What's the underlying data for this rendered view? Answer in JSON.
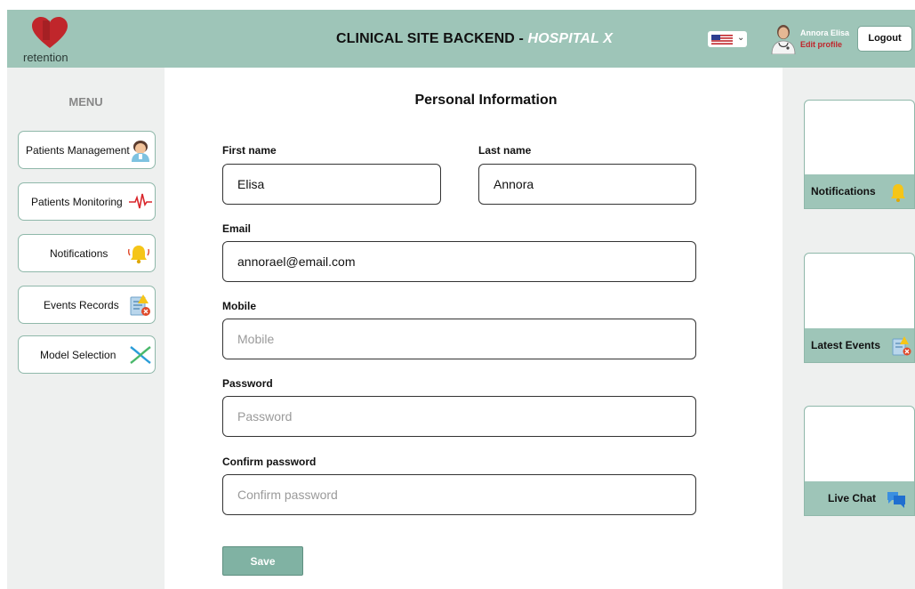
{
  "header": {
    "logo_text": "retention",
    "title": "CLINICAL SITE BACKEND - ",
    "hospital": "HOSPITAL X",
    "language_icon": "us-flag-icon",
    "user_name": "Annora Elisa",
    "edit_profile": "Edit profile",
    "logout": "Logout"
  },
  "sidebar": {
    "title": "MENU",
    "items": [
      {
        "label": "Patients Management",
        "icon": "doctor-icon"
      },
      {
        "label": "Patients Monitoring",
        "icon": "heartbeat-icon"
      },
      {
        "label": "Notifications",
        "icon": "bell-icon"
      },
      {
        "label": "Events Records",
        "icon": "event-list-icon"
      },
      {
        "label": "Model Selection",
        "icon": "model-cross-icon"
      }
    ]
  },
  "form": {
    "title": "Personal Information",
    "first_name_label": "First name",
    "first_name_value": "Elisa",
    "last_name_label": "Last name",
    "last_name_value": "Annora",
    "email_label": "Email",
    "email_value": "annorael@email.com",
    "mobile_label": "Mobile",
    "mobile_placeholder": "Mobile",
    "password_label": "Password",
    "password_placeholder": "Password",
    "confirm_label": "Confirm password",
    "confirm_placeholder": "Confirm password",
    "save": "Save"
  },
  "right_panel": {
    "cards": [
      {
        "label": "Notifications",
        "icon": "bell-icon"
      },
      {
        "label": "Latest Events",
        "icon": "event-list-icon"
      },
      {
        "label": "Live Chat",
        "icon": "chat-icon"
      }
    ]
  },
  "colors": {
    "header_bg": "#9ec5b8",
    "accent": "#80b2a3",
    "logo_red": "#c0262b",
    "hospital_text": "#ffffff"
  }
}
